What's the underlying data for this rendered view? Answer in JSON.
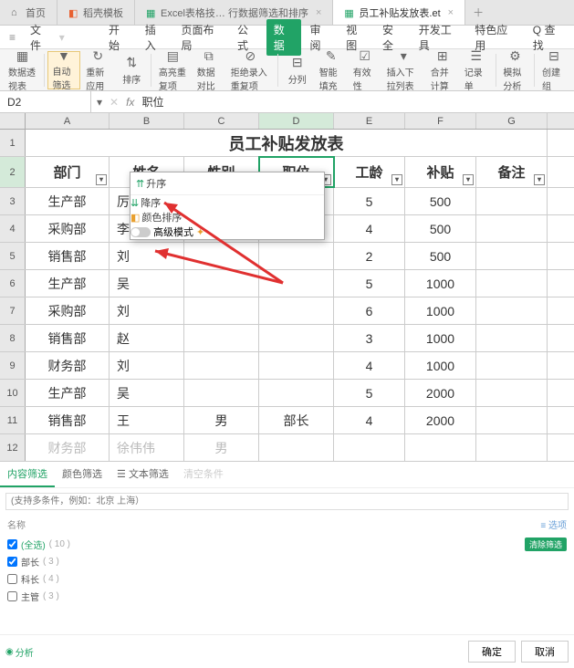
{
  "tabs": [
    {
      "label": "首页"
    },
    {
      "label": "稻壳模板"
    },
    {
      "label": "Excel表格技… 行数据筛选和排序"
    },
    {
      "label": "员工补贴发放表.et"
    }
  ],
  "menu": {
    "hamburger": "≡",
    "file": "文件",
    "items": [
      "开始",
      "插入",
      "页面布局",
      "公式",
      "数据",
      "审阅",
      "视图",
      "安全",
      "开发工具",
      "特色应用"
    ],
    "search": "Q 查找"
  },
  "ribbon": {
    "pivot": "数据透视表",
    "autofilter": "自动筛选",
    "reapply": "重新应用",
    "sort": "排序",
    "dup": "高亮重复项",
    "validate": "数据对比",
    "reject": "拒绝录入重复项",
    "split": "分列",
    "fill": "智能填充",
    "valid": "有效性",
    "dropdown": "插入下拉列表",
    "consolidate": "合并计算",
    "record": "记录单",
    "simulate": "模拟分析",
    "group": "创建组"
  },
  "namebox": "D2",
  "formula": "职位",
  "columns": [
    "A",
    "B",
    "C",
    "D",
    "E",
    "F",
    "G"
  ],
  "title_row": {
    "text": "员工补贴发放表"
  },
  "headers": [
    "部门",
    "姓名",
    "性别",
    "职位",
    "工龄",
    "补贴",
    "备注"
  ],
  "rows": [
    {
      "n": "3",
      "dept": "生产部",
      "name": "厉",
      "e": "5",
      "f": "500"
    },
    {
      "n": "4",
      "dept": "采购部",
      "name": "李",
      "e": "4",
      "f": "500"
    },
    {
      "n": "5",
      "dept": "销售部",
      "name": "刘",
      "e": "2",
      "f": "500"
    },
    {
      "n": "6",
      "dept": "生产部",
      "name": "吴",
      "e": "5",
      "f": "1000"
    },
    {
      "n": "7",
      "dept": "采购部",
      "name": "刘",
      "e": "6",
      "f": "1000"
    },
    {
      "n": "8",
      "dept": "销售部",
      "name": "赵",
      "e": "3",
      "f": "1000"
    },
    {
      "n": "9",
      "dept": "财务部",
      "name": "刘",
      "e": "4",
      "f": "1000"
    },
    {
      "n": "10",
      "dept": "生产部",
      "name": "吴",
      "e": "5",
      "f": "2000"
    },
    {
      "n": "11",
      "dept": "销售部",
      "name": "王",
      "sex": "男",
      "pos": "部长",
      "e": "4",
      "f": "2000"
    },
    {
      "n": "12",
      "dept": "财务部",
      "name": "徐伟伟",
      "sex": "男",
      "faded": true
    }
  ],
  "filter": {
    "asc": "升序",
    "desc": "降序",
    "color_sort": "颜色排序",
    "adv_mode": "高级模式",
    "tab_content": "内容筛选",
    "tab_color": "颜色筛选",
    "tab_text": "文本筛选",
    "tab_clear": "清空条件",
    "search_ph": "(支持多条件，例如：北京 上海）",
    "name_hdr": "名称",
    "options": "选项",
    "items": [
      {
        "label": "(全选)",
        "count": "( 10 )",
        "checked": true,
        "sel": true
      },
      {
        "label": "部长",
        "count": "( 3 )",
        "checked": true
      },
      {
        "label": "科长",
        "count": "( 4 )",
        "checked": false
      },
      {
        "label": "主管",
        "count": "( 3 )",
        "checked": false
      }
    ],
    "clear": "清除筛选",
    "analyze": "分析",
    "ok": "确定",
    "cancel": "取消"
  }
}
